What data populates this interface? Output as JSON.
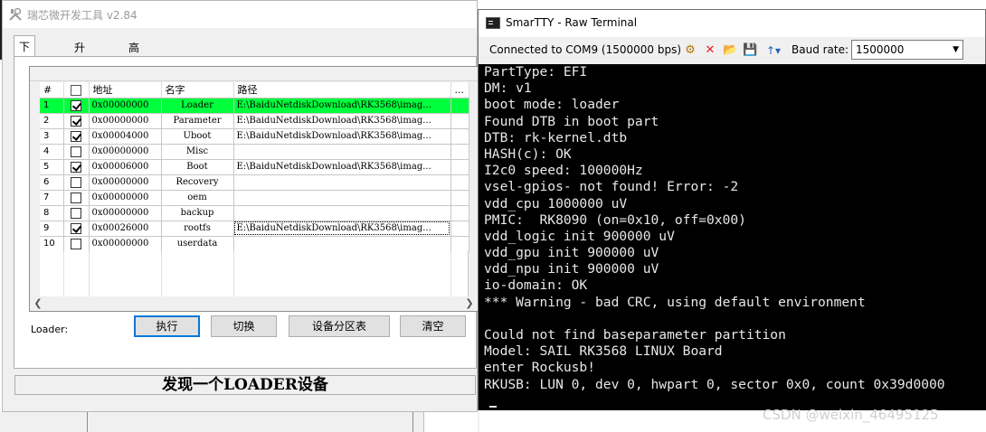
{
  "rktool": {
    "title": "瑞芯微开发工具 v2.84",
    "tabs": [
      "下载镜像",
      "升级固件",
      "高级功能"
    ],
    "columns": [
      "#",
      "地址",
      "名字",
      "路径",
      "..."
    ],
    "rows": [
      {
        "num": "1",
        "checked": true,
        "address": "0x00000000",
        "name": "Loader",
        "path": "E:\\BaiduNetdiskDownload\\RK3568\\imag...",
        "highlight": true
      },
      {
        "num": "2",
        "checked": true,
        "address": "0x00000000",
        "name": "Parameter",
        "path": "E:\\BaiduNetdiskDownload\\RK3568\\imag..."
      },
      {
        "num": "3",
        "checked": true,
        "address": "0x00004000",
        "name": "Uboot",
        "path": "E:\\BaiduNetdiskDownload\\RK3568\\imag..."
      },
      {
        "num": "4",
        "checked": false,
        "address": "0x00000000",
        "name": "Misc",
        "path": ""
      },
      {
        "num": "5",
        "checked": true,
        "address": "0x00006000",
        "name": "Boot",
        "path": "E:\\BaiduNetdiskDownload\\RK3568\\imag..."
      },
      {
        "num": "6",
        "checked": false,
        "address": "0x00000000",
        "name": "Recovery",
        "path": ""
      },
      {
        "num": "7",
        "checked": false,
        "address": "0x00000000",
        "name": "oem",
        "path": ""
      },
      {
        "num": "8",
        "checked": false,
        "address": "0x00000000",
        "name": "backup",
        "path": ""
      },
      {
        "num": "9",
        "checked": true,
        "address": "0x00026000",
        "name": "rootfs",
        "path": "E:\\BaiduNetdiskDownload\\RK3568\\imag...",
        "focused": true
      },
      {
        "num": "10",
        "checked": false,
        "address": "0x00000000",
        "name": "userdata",
        "path": ""
      }
    ],
    "loader_label": "Loader:",
    "buttons": {
      "run": "执行",
      "switch": "切换",
      "partition_table": "设备分区表",
      "clear": "清空"
    },
    "status": "发现一个LOADER设备",
    "highlight_color": "#00ff3c"
  },
  "smartty": {
    "title": "SmarTTY - Raw Terminal",
    "connection": "Connected to COM9 (1500000 bps)",
    "baud_label": "Baud rate:",
    "baud_value": "1500000",
    "terminal_lines": [
      "PartType: EFI",
      "DM: v1",
      "boot mode: loader",
      "Found DTB in boot part",
      "DTB: rk-kernel.dtb",
      "HASH(c): OK",
      "I2c0 speed: 100000Hz",
      "vsel-gpios- not found! Error: -2",
      "vdd_cpu 1000000 uV",
      "PMIC:  RK8090 (on=0x10, off=0x00)",
      "vdd_logic init 900000 uV",
      "vdd_gpu init 900000 uV",
      "vdd_npu init 900000 uV",
      "io-domain: OK",
      "*** Warning - bad CRC, using default environment",
      "",
      "Could not find baseparameter partition",
      "Model: SAIL RK3568 LINUX Board",
      "enter Rockusb!",
      "RKUSB: LUN 0, dev 0, hwpart 0, sector 0x0, count 0x39d0000"
    ],
    "prompt": "|"
  },
  "watermark": "CSDN @weixin_46495125"
}
